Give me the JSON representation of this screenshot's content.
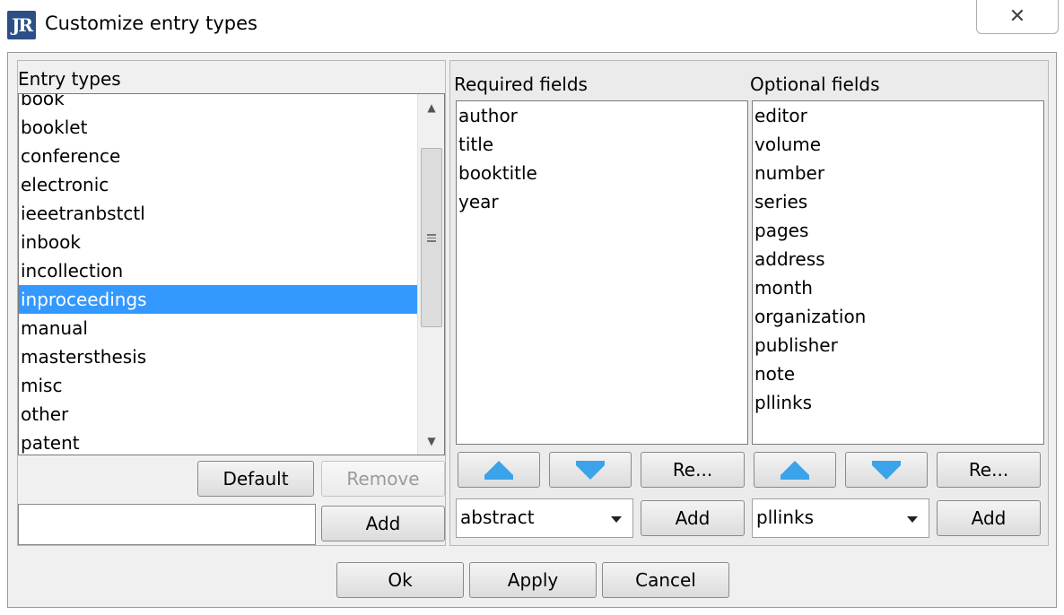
{
  "window": {
    "title": "Customize entry types",
    "app_icon_text": "JR",
    "close_symbol": "✕"
  },
  "left": {
    "label": "Entry types",
    "items": [
      "book",
      "booklet",
      "conference",
      "electronic",
      "ieeetranbstctl",
      "inbook",
      "incollection",
      "inproceedings",
      "manual",
      "mastersthesis",
      "misc",
      "other",
      "patent"
    ],
    "selected": "inproceedings",
    "default_label": "Default",
    "remove_label": "Remove",
    "new_type_value": "",
    "add_label": "Add"
  },
  "required": {
    "label": "Required fields",
    "items": [
      "author",
      "title",
      "booktitle",
      "year"
    ],
    "remove_label": "Re...",
    "combo_value": "abstract",
    "add_label": "Add"
  },
  "optional": {
    "label": "Optional fields",
    "items": [
      "editor",
      "volume",
      "number",
      "series",
      "pages",
      "address",
      "month",
      "organization",
      "publisher",
      "note",
      "pllinks"
    ],
    "remove_label": "Re...",
    "combo_value": "pllinks",
    "add_label": "Add"
  },
  "footer": {
    "ok_label": "Ok",
    "apply_label": "Apply",
    "cancel_label": "Cancel"
  },
  "icons": {
    "move_up": "arrow-up-icon",
    "move_down": "arrow-down-icon",
    "accent": "#3aa3ea",
    "selection": "#3399ff"
  }
}
